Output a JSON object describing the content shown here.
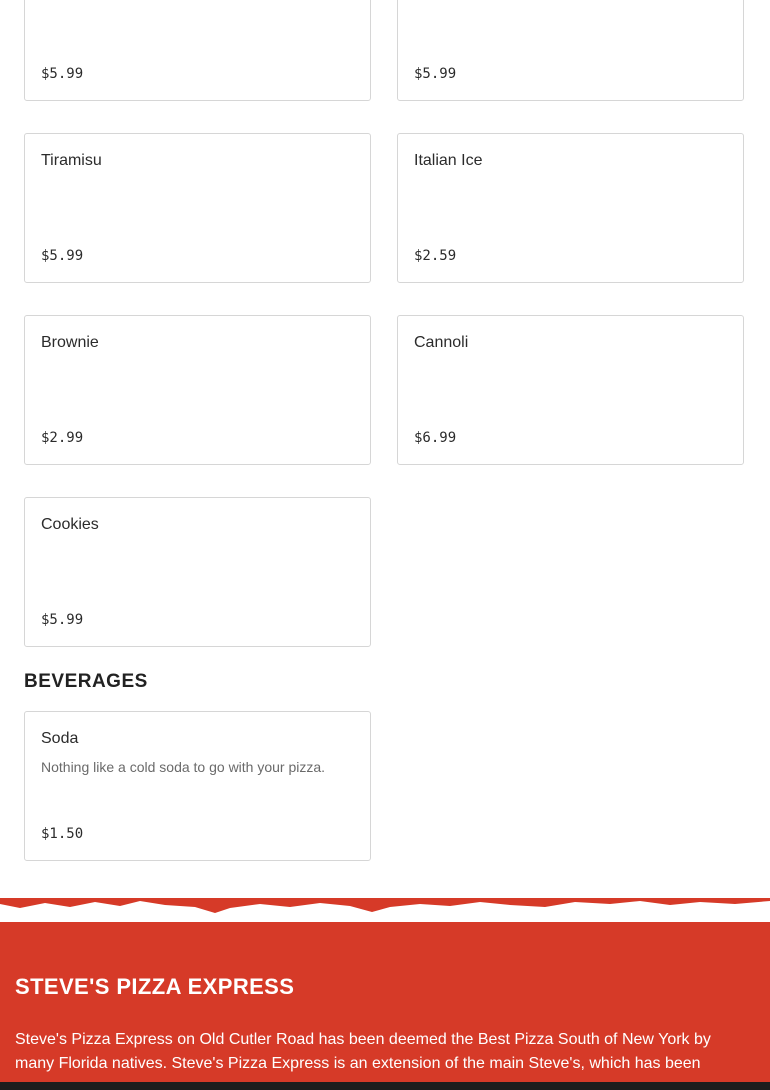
{
  "menu": {
    "top_cards": [
      {
        "price": "$5.99"
      },
      {
        "price": "$5.99"
      }
    ],
    "desserts": [
      {
        "name": "Tiramisu",
        "price": "$5.99"
      },
      {
        "name": "Italian Ice",
        "price": "$2.59"
      },
      {
        "name": "Brownie",
        "price": "$2.99"
      },
      {
        "name": "Cannoli",
        "price": "$6.99"
      },
      {
        "name": "Cookies",
        "price": "$5.99"
      }
    ],
    "beverages_title": "BEVERAGES",
    "beverages": [
      {
        "name": "Soda",
        "description": "Nothing like a cold soda to go with your pizza.",
        "price": "$1.50"
      }
    ]
  },
  "footer": {
    "brand": "STEVE'S PIZZA EXPRESS",
    "about": "Steve's Pizza Express on Old Cutler Road has been deemed the Best Pizza South of New York by many Florida natives. Steve's Pizza Express is an extension of the main Steve's, which has been"
  },
  "colors": {
    "brand_red": "#d63a28",
    "card_border": "#d6d6d6"
  }
}
